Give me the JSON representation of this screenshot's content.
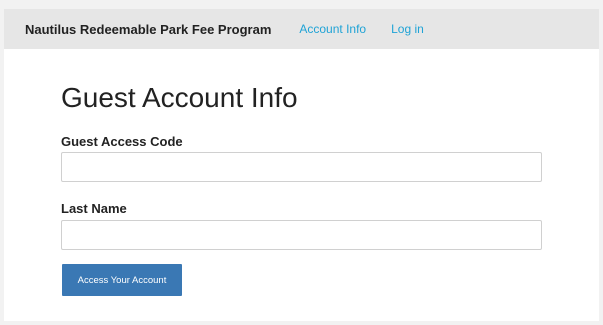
{
  "navbar": {
    "brand": "Nautilus Redeemable Park Fee Program",
    "links": [
      {
        "label": "Account Info"
      },
      {
        "label": "Log in"
      }
    ]
  },
  "main": {
    "title": "Guest Account Info",
    "fields": [
      {
        "label": "Guest Access Code",
        "value": "",
        "placeholder": ""
      },
      {
        "label": "Last Name",
        "value": "",
        "placeholder": ""
      }
    ],
    "submit_label": "Access Your Account"
  },
  "colors": {
    "link": "#1fa3d6",
    "button": "#3a78b4",
    "navbar_bg": "#e6e6e6"
  }
}
